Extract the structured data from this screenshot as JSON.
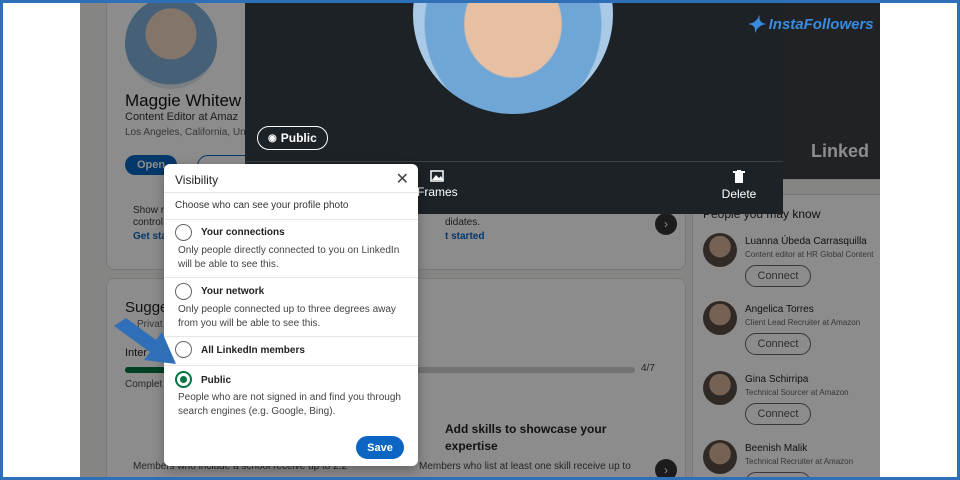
{
  "profile": {
    "name": "Maggie Whitew",
    "headline": "Content Editor at Amaz",
    "location": "Los Angeles, California, Uni",
    "open_label": "Open",
    "show_text_1": "Show r",
    "show_text_2": "control",
    "get_started_1": "Get sta",
    "didates_text": "didates.",
    "get_started_2": "t started"
  },
  "suggested": {
    "title": "Sugge",
    "private_text": "Privat",
    "intermediate_text": "Inter",
    "complete_text": "Complet",
    "progress_text": "4/7",
    "progress_fraction": 0.57,
    "card1_text": "Members who include a school receive up to 2.2",
    "card2_title": "Add skills to showcase your expertise",
    "card2_text": "Members who list at least one skill receive up to"
  },
  "people": {
    "heading": "People you may know",
    "connect_label": "Connect",
    "items": [
      {
        "name": "Luanna Úbeda Carrasquilla",
        "title": "Content editor at HR Global Content"
      },
      {
        "name": "Angelica Torres",
        "title": "Client Lead Recruiter at Amazon"
      },
      {
        "name": "Gina Schirripa",
        "title": "Technical Sourcer at Amazon"
      },
      {
        "name": "Beenish Malik",
        "title": "Technical Recruiter at Amazon"
      }
    ]
  },
  "ad": {
    "brand_text": "Linked"
  },
  "watermark": "InstaFollowers",
  "photo_modal": {
    "visibility_pill": "Public",
    "tools": [
      {
        "label": "Frames",
        "icon": "image-icon"
      },
      {
        "label": "Delete",
        "icon": "trash-icon"
      }
    ]
  },
  "visibility_dialog": {
    "title": "Visibility",
    "subtitle": "Choose who can see your profile photo",
    "options": [
      {
        "label": "Your connections",
        "desc": "Only people directly connected to you on LinkedIn will be able to see this.",
        "selected": false
      },
      {
        "label": "Your network",
        "desc": "Only people connected up to three degrees away from you will be able to see this.",
        "selected": false
      },
      {
        "label": "All LinkedIn members",
        "desc": "",
        "selected": false
      },
      {
        "label": "Public",
        "desc": "People who are not signed in and find you through search engines (e.g. Google, Bing).",
        "selected": true
      }
    ],
    "save_label": "Save"
  },
  "colors": {
    "accent": "#0a66c2",
    "selected_radio": "#057642",
    "frame": "#2f6fb7",
    "arrow": "#2f6fb7"
  }
}
